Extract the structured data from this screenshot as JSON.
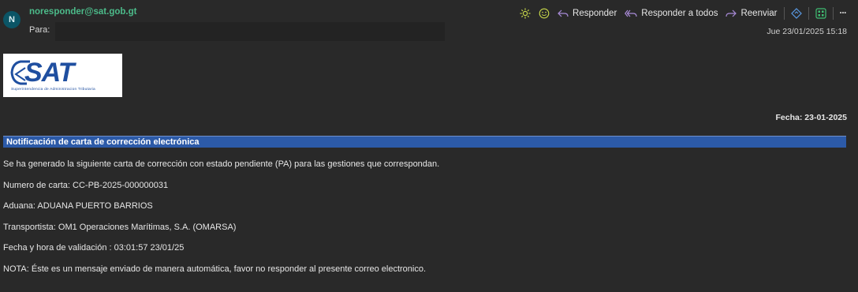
{
  "header": {
    "avatar_initial": "N",
    "sender": "noresponder@sat.gob.gt",
    "to_label": "Para:",
    "date": "Jue 23/01/2025 15:18"
  },
  "toolbar": {
    "reply_label": "Responder",
    "reply_all_label": "Responder a todos",
    "forward_label": "Reenviar",
    "more_label": "···"
  },
  "email": {
    "logo_text": "SAT",
    "logo_subtitle": "Superintendencia de Administracion Tributaria",
    "fecha": "Fecha: 23-01-2025",
    "banner_title": "Notificación de carta de corrección electrónica",
    "lines": [
      "Se ha generado la siguiente carta de corrección con estado pendiente (PA) para las gestiones que correspondan.",
      "Numero de carta: CC-PB-2025-000000031",
      "Aduana: ADUANA PUERTO BARRIOS",
      "Transportista: OM1 Operaciones Marítimas, S.A. (OMARSA)",
      "Fecha y hora de validación : 03:01:57 23/01/25",
      "NOTA: Éste es un mensaje enviado de manera automática, favor no responder al presente correo electronico."
    ]
  },
  "colors": {
    "background": "#292929",
    "sender": "#4cbb8a",
    "banner": "#2c5aa8",
    "avatar": "#0b5566",
    "accent_icon": "#a98bd8"
  }
}
